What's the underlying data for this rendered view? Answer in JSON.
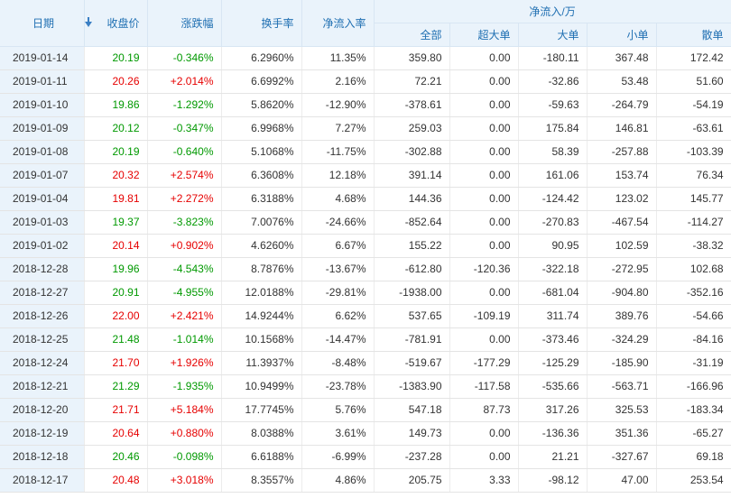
{
  "colors": {
    "up": "#e60000",
    "down": "#009900",
    "header_text": "#1f6fb2",
    "header_bg": "#eaf3fb"
  },
  "header": {
    "date": "日期",
    "close": "收盘价",
    "change": "涨跌幅",
    "turnover": "换手率",
    "net_ratio": "净流入率",
    "net_group": "净流入/万",
    "all": "全部",
    "super_large": "超大单",
    "large": "大单",
    "small": "小单",
    "retail": "散单",
    "sort_icon": "sort-down-arrow-icon"
  },
  "rows": [
    {
      "date": "2019-01-14",
      "close": "20.19",
      "dir": "down",
      "change": "-0.346%",
      "turnover": "6.2960%",
      "ratio": "11.35%",
      "all": "359.80",
      "super": "0.00",
      "large": "-180.11",
      "small": "367.48",
      "retail": "172.42"
    },
    {
      "date": "2019-01-11",
      "close": "20.26",
      "dir": "up",
      "change": "+2.014%",
      "turnover": "6.6992%",
      "ratio": "2.16%",
      "all": "72.21",
      "super": "0.00",
      "large": "-32.86",
      "small": "53.48",
      "retail": "51.60"
    },
    {
      "date": "2019-01-10",
      "close": "19.86",
      "dir": "down",
      "change": "-1.292%",
      "turnover": "5.8620%",
      "ratio": "-12.90%",
      "all": "-378.61",
      "super": "0.00",
      "large": "-59.63",
      "small": "-264.79",
      "retail": "-54.19"
    },
    {
      "date": "2019-01-09",
      "close": "20.12",
      "dir": "down",
      "change": "-0.347%",
      "turnover": "6.9968%",
      "ratio": "7.27%",
      "all": "259.03",
      "super": "0.00",
      "large": "175.84",
      "small": "146.81",
      "retail": "-63.61"
    },
    {
      "date": "2019-01-08",
      "close": "20.19",
      "dir": "down",
      "change": "-0.640%",
      "turnover": "5.1068%",
      "ratio": "-11.75%",
      "all": "-302.88",
      "super": "0.00",
      "large": "58.39",
      "small": "-257.88",
      "retail": "-103.39"
    },
    {
      "date": "2019-01-07",
      "close": "20.32",
      "dir": "up",
      "change": "+2.574%",
      "turnover": "6.3608%",
      "ratio": "12.18%",
      "all": "391.14",
      "super": "0.00",
      "large": "161.06",
      "small": "153.74",
      "retail": "76.34"
    },
    {
      "date": "2019-01-04",
      "close": "19.81",
      "dir": "up",
      "change": "+2.272%",
      "turnover": "6.3188%",
      "ratio": "4.68%",
      "all": "144.36",
      "super": "0.00",
      "large": "-124.42",
      "small": "123.02",
      "retail": "145.77"
    },
    {
      "date": "2019-01-03",
      "close": "19.37",
      "dir": "down",
      "change": "-3.823%",
      "turnover": "7.0076%",
      "ratio": "-24.66%",
      "all": "-852.64",
      "super": "0.00",
      "large": "-270.83",
      "small": "-467.54",
      "retail": "-114.27"
    },
    {
      "date": "2019-01-02",
      "close": "20.14",
      "dir": "up",
      "change": "+0.902%",
      "turnover": "4.6260%",
      "ratio": "6.67%",
      "all": "155.22",
      "super": "0.00",
      "large": "90.95",
      "small": "102.59",
      "retail": "-38.32"
    },
    {
      "date": "2018-12-28",
      "close": "19.96",
      "dir": "down",
      "change": "-4.543%",
      "turnover": "8.7876%",
      "ratio": "-13.67%",
      "all": "-612.80",
      "super": "-120.36",
      "large": "-322.18",
      "small": "-272.95",
      "retail": "102.68"
    },
    {
      "date": "2018-12-27",
      "close": "20.91",
      "dir": "down",
      "change": "-4.955%",
      "turnover": "12.0188%",
      "ratio": "-29.81%",
      "all": "-1938.00",
      "super": "0.00",
      "large": "-681.04",
      "small": "-904.80",
      "retail": "-352.16"
    },
    {
      "date": "2018-12-26",
      "close": "22.00",
      "dir": "up",
      "change": "+2.421%",
      "turnover": "14.9244%",
      "ratio": "6.62%",
      "all": "537.65",
      "super": "-109.19",
      "large": "311.74",
      "small": "389.76",
      "retail": "-54.66"
    },
    {
      "date": "2018-12-25",
      "close": "21.48",
      "dir": "down",
      "change": "-1.014%",
      "turnover": "10.1568%",
      "ratio": "-14.47%",
      "all": "-781.91",
      "super": "0.00",
      "large": "-373.46",
      "small": "-324.29",
      "retail": "-84.16"
    },
    {
      "date": "2018-12-24",
      "close": "21.70",
      "dir": "up",
      "change": "+1.926%",
      "turnover": "11.3937%",
      "ratio": "-8.48%",
      "all": "-519.67",
      "super": "-177.29",
      "large": "-125.29",
      "small": "-185.90",
      "retail": "-31.19"
    },
    {
      "date": "2018-12-21",
      "close": "21.29",
      "dir": "down",
      "change": "-1.935%",
      "turnover": "10.9499%",
      "ratio": "-23.78%",
      "all": "-1383.90",
      "super": "-117.58",
      "large": "-535.66",
      "small": "-563.71",
      "retail": "-166.96"
    },
    {
      "date": "2018-12-20",
      "close": "21.71",
      "dir": "up",
      "change": "+5.184%",
      "turnover": "17.7745%",
      "ratio": "5.76%",
      "all": "547.18",
      "super": "87.73",
      "large": "317.26",
      "small": "325.53",
      "retail": "-183.34"
    },
    {
      "date": "2018-12-19",
      "close": "20.64",
      "dir": "up",
      "change": "+0.880%",
      "turnover": "8.0388%",
      "ratio": "3.61%",
      "all": "149.73",
      "super": "0.00",
      "large": "-136.36",
      "small": "351.36",
      "retail": "-65.27"
    },
    {
      "date": "2018-12-18",
      "close": "20.46",
      "dir": "down",
      "change": "-0.098%",
      "turnover": "6.6188%",
      "ratio": "-6.99%",
      "all": "-237.28",
      "super": "0.00",
      "large": "21.21",
      "small": "-327.67",
      "retail": "69.18"
    },
    {
      "date": "2018-12-17",
      "close": "20.48",
      "dir": "up",
      "change": "+3.018%",
      "turnover": "8.3557%",
      "ratio": "4.86%",
      "all": "205.75",
      "super": "3.33",
      "large": "-98.12",
      "small": "47.00",
      "retail": "253.54"
    }
  ]
}
